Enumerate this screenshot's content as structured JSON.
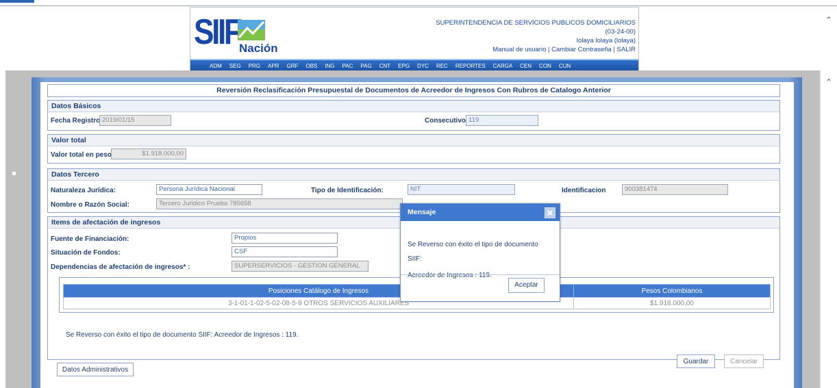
{
  "header": {
    "logo_text": "SIIF",
    "logo_sub": "Nación",
    "org_name": "SUPERINTENDENCIA DE SERVICIOS PUBLICOS DOMICILIARIOS",
    "code": "(03-24-00)",
    "user": "lolaya lolaya (lolaya)",
    "links": [
      "Manual de usuario",
      "Cambiar Contraseña",
      "SALIR"
    ],
    "link_sep": "|",
    "menu": [
      "ADM",
      "SEG",
      "PRG",
      "APR",
      "GRF",
      "OBS",
      "ING",
      "PAC",
      "PAG",
      "CNT",
      "EPG",
      "DYC",
      "REC",
      "REPORTES",
      "CARGA",
      "CEN",
      "CON",
      "CUN"
    ]
  },
  "form": {
    "title": "Reversión Reclasificación Presupuestal de Documentos de Acreedor de Ingresos Con Rubros de Catalogo Anterior",
    "basic": {
      "header": "Datos Básicos",
      "fecha_label": "Fecha Registro:",
      "fecha_value": "2019/01/15",
      "consecutivo_label": "Consecutivo :",
      "consecutivo_value": "119"
    },
    "valor": {
      "header": "Valor total",
      "label": "Valor total en pesos",
      "value": "$1.918.000,00"
    },
    "tercero": {
      "header": "Datos Tercero",
      "naturaleza_label": "Naturaleza Jurídica:",
      "naturaleza_value": "Persona Jurídica Nacional",
      "tipo_label": "Tipo de Identificación:",
      "tipo_value": "NIT",
      "ident_label": "Identificacion",
      "ident_value": "900381474",
      "nombre_label": "Nombre o Razón Social:",
      "nombre_value": "Tercero Juridico Prueba 785658"
    },
    "items": {
      "header": "Items de afectación de ingresos",
      "fuente_label": "Fuente de Financiación:",
      "fuente_value": "Propios",
      "situacion_label": "Situación de Fondos:",
      "situacion_value": "CSF",
      "dependencias_label": "Dependencias de afectación de ingresos* :",
      "dependencias_value": "SUPERSERVICIOS - GESTION GENERAL",
      "table": {
        "columns": [
          "Posiciones Catálogo de Ingresos",
          "Pesos Colombianos"
        ],
        "rows": [
          [
            "3-1-01-1-02-5-02-08-5-9 OTROS SERVICIOS AUXILIARES",
            "$1.918.000,00"
          ]
        ]
      }
    },
    "result_message": "Se Reverso con éxito el tipo de documento SIIF: Acreedor de Ingresos : 119.",
    "buttons": {
      "datos_admin": "Datos Administrativos",
      "guardar": "Guardar",
      "cancelar": "Cancelar"
    }
  },
  "modal": {
    "title": "Mensaje",
    "line1": "Se Reverso con éxito el tipo de documento SIIF:",
    "line2": "Acreedor de Ingresos : 119.",
    "ok": "Aceptar"
  },
  "colors": {
    "brand_blue": "#1847a8",
    "header_bar": "#3f78cf",
    "frame_blue": "#7ea4d6"
  }
}
